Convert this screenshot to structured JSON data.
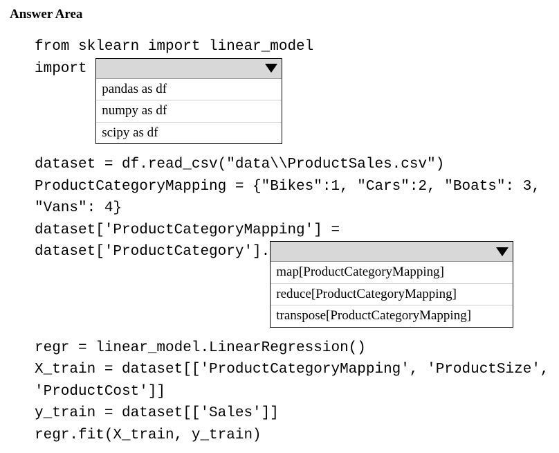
{
  "title": "Answer Area",
  "code": {
    "l1": "from sklearn import linear_model",
    "l2_prefix": "import ",
    "l3": "dataset = df.read_csv(\"data\\\\ProductSales.csv\")",
    "l4": "ProductCategoryMapping = {\"Bikes\":1, \"Cars\":2, \"Boats\": 3,",
    "l5": "\"Vans\": 4}",
    "l6": "dataset['ProductCategoryMapping'] =",
    "l7_prefix": "dataset['ProductCategory'].",
    "l8": "regr = linear_model.LinearRegression()",
    "l9": "X_train = dataset[['ProductCategoryMapping', 'ProductSize',",
    "l10": "'ProductCost']]",
    "l11": "y_train = dataset[['Sales']]",
    "l12": "regr.fit(X_train, y_train)"
  },
  "dropdown1": {
    "options": [
      "pandas as df",
      "numpy as df",
      "scipy as df"
    ]
  },
  "dropdown2": {
    "options": [
      "map[ProductCategoryMapping]",
      "reduce[ProductCategoryMapping]",
      "transpose[ProductCategoryMapping]"
    ]
  }
}
